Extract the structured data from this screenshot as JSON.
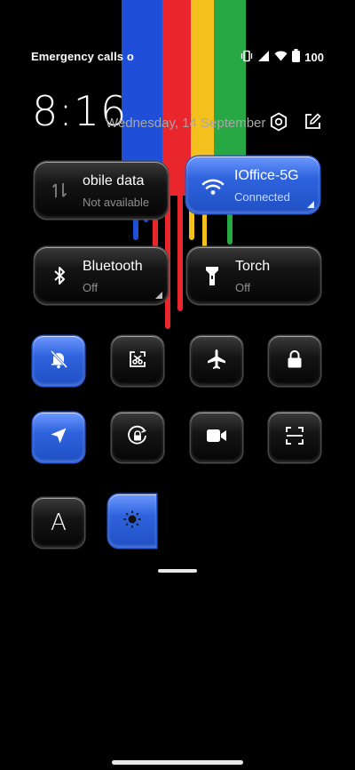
{
  "status_bar": {
    "carrier_text": "Emergency calls o",
    "battery": "100",
    "icons": [
      "vibrate-icon",
      "signal-icon",
      "wifi-icon",
      "battery-icon"
    ]
  },
  "header": {
    "time": "8:16",
    "date": "Wednesday, 14 September",
    "icons": [
      "settings-icon",
      "edit-icon"
    ]
  },
  "tiles": {
    "mobile_data": {
      "title": "obile data",
      "subtitle": "Not available",
      "active": false,
      "icon": "mobile-data-icon"
    },
    "wifi": {
      "title": "IOffice-5G",
      "subtitle": "Connected",
      "active": true,
      "icon": "wifi-icon"
    },
    "bluetooth": {
      "title": "Bluetooth",
      "subtitle": "Off",
      "active": false,
      "icon": "bluetooth-icon"
    },
    "torch": {
      "title": "Torch",
      "subtitle": "Off",
      "active": false,
      "icon": "torch-icon"
    }
  },
  "small_tiles": [
    {
      "name": "do-not-disturb",
      "icon": "bell-off-icon",
      "active": true
    },
    {
      "name": "screen-cast",
      "icon": "cast-icon",
      "active": false
    },
    {
      "name": "airplane-mode",
      "icon": "airplane-icon",
      "active": false
    },
    {
      "name": "lock",
      "icon": "lock-icon",
      "active": false
    },
    {
      "name": "location",
      "icon": "location-icon",
      "active": true
    },
    {
      "name": "auto-rotate",
      "icon": "rotate-icon",
      "active": false
    },
    {
      "name": "screen-record",
      "icon": "video-icon",
      "active": false
    },
    {
      "name": "scan",
      "icon": "scan-icon",
      "active": false
    },
    {
      "name": "font",
      "icon": "font-icon",
      "active": false
    },
    {
      "name": "brightness",
      "icon": "brightness-icon",
      "active": true
    }
  ],
  "font_tile_glyph": "A",
  "colors": {
    "accent": "#2f63dd",
    "stripe_blue": "#1f4fd8",
    "stripe_red": "#e8262b",
    "stripe_yellow": "#f4c01d",
    "stripe_green": "#27a845"
  }
}
